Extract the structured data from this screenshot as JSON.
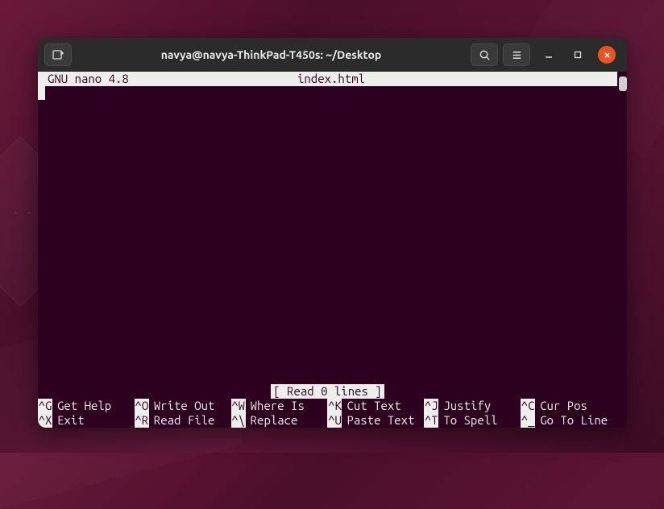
{
  "window": {
    "title": "navya@navya-ThinkPad-T450s: ~/Desktop"
  },
  "nano": {
    "version": "GNU nano 4.8",
    "filename": "index.html",
    "status": "[ Read 0 lines ]"
  },
  "shortcuts": {
    "row1": [
      {
        "key": "^G",
        "label": "Get Help"
      },
      {
        "key": "^O",
        "label": "Write Out"
      },
      {
        "key": "^W",
        "label": "Where Is"
      },
      {
        "key": "^K",
        "label": "Cut Text"
      },
      {
        "key": "^J",
        "label": "Justify"
      },
      {
        "key": "^C",
        "label": "Cur Pos"
      }
    ],
    "row2": [
      {
        "key": "^X",
        "label": "Exit"
      },
      {
        "key": "^R",
        "label": "Read File"
      },
      {
        "key": "^\\",
        "label": "Replace"
      },
      {
        "key": "^U",
        "label": "Paste Text"
      },
      {
        "key": "^T",
        "label": "To Spell"
      },
      {
        "key": "^_",
        "label": "Go To Line"
      }
    ]
  }
}
